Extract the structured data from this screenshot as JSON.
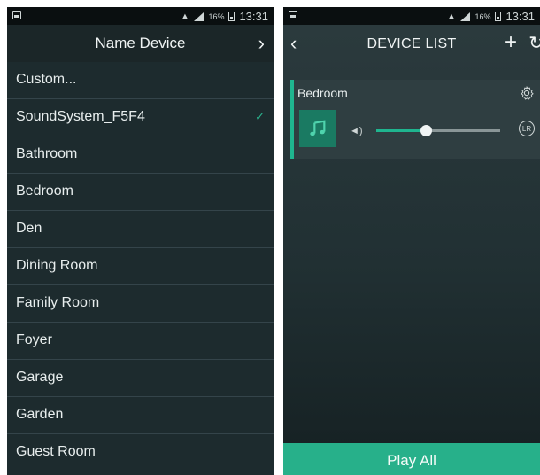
{
  "left": {
    "status": {
      "battery": "16%",
      "time": "13:31"
    },
    "header": {
      "title": "Name Device",
      "next_icon": "chevron-right-icon"
    },
    "items": [
      {
        "label": "Custom...",
        "selected": false
      },
      {
        "label": "SoundSystem_F5F4",
        "selected": true
      },
      {
        "label": "Bathroom",
        "selected": false
      },
      {
        "label": "Bedroom",
        "selected": false
      },
      {
        "label": "Den",
        "selected": false
      },
      {
        "label": "Dining Room",
        "selected": false
      },
      {
        "label": "Family Room",
        "selected": false
      },
      {
        "label": "Foyer",
        "selected": false
      },
      {
        "label": "Garage",
        "selected": false
      },
      {
        "label": "Garden",
        "selected": false
      },
      {
        "label": "Guest Room",
        "selected": false
      }
    ],
    "check_mark": "✓"
  },
  "right": {
    "status": {
      "battery": "16%",
      "time": "13:31"
    },
    "header": {
      "title": "DEVICE LIST",
      "back_icon": "chevron-left-icon",
      "add_icon": "plus-icon",
      "refresh_icon": "refresh-icon"
    },
    "device": {
      "name": "Bedroom",
      "volume_fraction": 0.4,
      "channel_badge": "LR"
    },
    "footer": {
      "play_all_label": "Play All"
    }
  },
  "colors": {
    "accent": "#27b08a",
    "list_bg": "#1d2b2e"
  }
}
